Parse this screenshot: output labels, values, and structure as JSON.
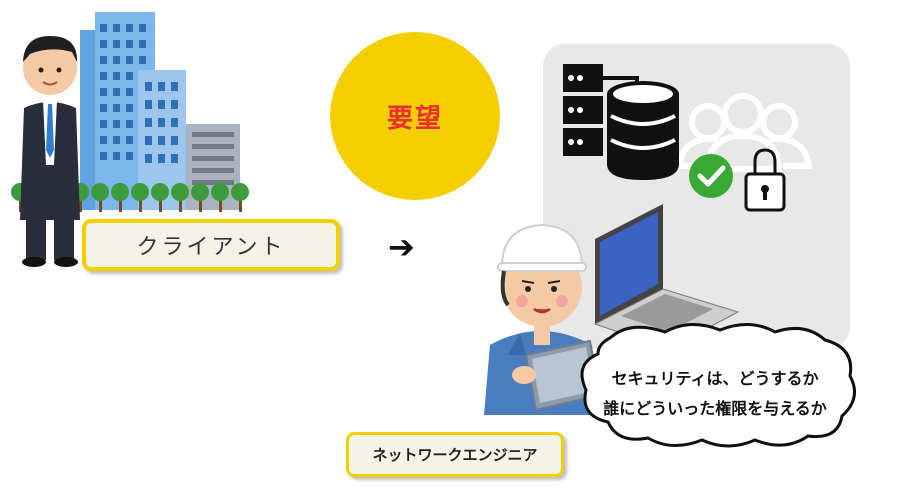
{
  "request_label": "要望",
  "arrow_symbol": "➔",
  "client_label": "クライアント",
  "engineer_label": "ネットワークエンジニア",
  "speech_bubble": {
    "line1": "セキュリティは、どうするか",
    "line2": "誰にどういった権限を与えるか"
  },
  "colors": {
    "accent_yellow": "#f4cf00",
    "request_text": "#e8312a",
    "check_green": "#3aa835",
    "laptop_screen": "#3b63c4",
    "panel_gray": "#e8e8e8"
  },
  "icons": [
    "server-icon",
    "database-icon",
    "check-icon",
    "lock-icon",
    "users-icon",
    "laptop-icon",
    "building-icon",
    "businessman-icon",
    "engineer-icon"
  ]
}
